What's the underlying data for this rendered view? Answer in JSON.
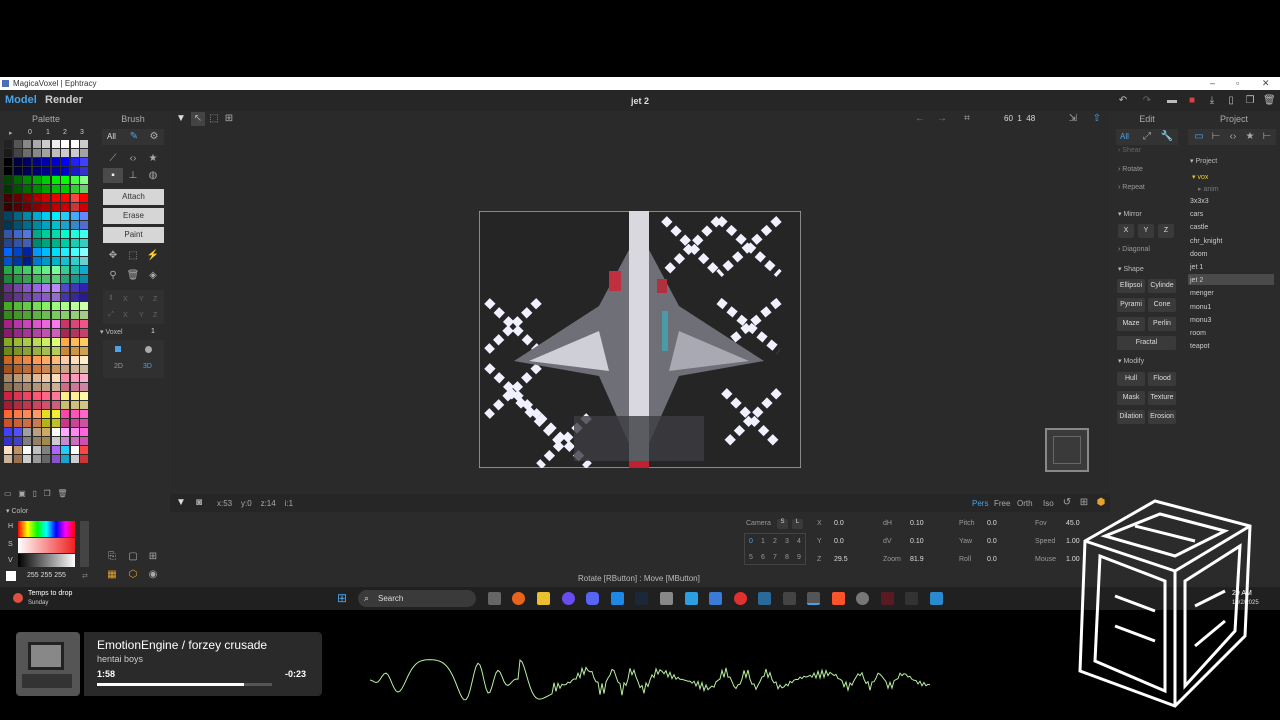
{
  "titlebar": {
    "title": "MagicaVoxel | Ephtracy"
  },
  "menubar": {
    "model": "Model",
    "render": "Render",
    "doc_title": "jet 2",
    "edit": "Edit",
    "project": "Project"
  },
  "palette": {
    "title": "Palette",
    "cols": [
      "0",
      "1",
      "2",
      "3"
    ]
  },
  "brush": {
    "title": "Brush",
    "all": "All",
    "attach": "Attach",
    "erase": "Erase",
    "paint": "Paint",
    "axes_x": "X",
    "axes_y": "Y",
    "axes_z": "Z",
    "voxel": "Voxel",
    "voxel_count": "1",
    "d2": "2D",
    "d3": "3D"
  },
  "color": {
    "title": "Color",
    "h": "H",
    "s": "S",
    "v": "V",
    "rgb": "255 255 255"
  },
  "viewport": {
    "dims": "60  1  48",
    "coords": "x:53    y:0    z:14    i:1",
    "status": "Rotate [RButton] : Move [MButton]"
  },
  "view_modes": {
    "pers": "Pers",
    "free": "Free",
    "orth": "Orth",
    "iso": "Iso"
  },
  "camera": {
    "camera": "Camera",
    "s": "S",
    "l": "L",
    "slots": [
      "0",
      "1",
      "2",
      "3",
      "4",
      "5",
      "6",
      "7",
      "8",
      "9"
    ],
    "x_label": "X",
    "x": "0.0",
    "y_label": "Y",
    "y": "0.0",
    "z_label": "Z",
    "z": "29.5",
    "dh_label": "dH",
    "dh": "0.10",
    "dv_label": "dV",
    "dv": "0.10",
    "zoom_label": "Zoom",
    "zoom": "81.9",
    "pitch_label": "Pitch",
    "pitch": "0.0",
    "yaw_label": "Yaw",
    "yaw": "0.0",
    "roll_label": "Roll",
    "roll": "0.0",
    "fov_label": "Fov",
    "fov": "45.0",
    "speed_label": "Speed",
    "speed": "1.00",
    "mouse_label": "Mouse",
    "mouse": "1.00"
  },
  "edit": {
    "all": "All",
    "shear": "Shear",
    "rotate": "Rotate",
    "repeat": "Repeat",
    "mirror": "Mirror",
    "mx": "X",
    "my": "Y",
    "mz": "Z",
    "diagonal": "Diagonal",
    "shape": "Shape",
    "ellipsoid": "Ellipsoi",
    "cylinder": "Cylinde",
    "pyramid": "Pyrami",
    "cone": "Cone",
    "maze": "Maze",
    "perlin": "Perlin",
    "fractal": "Fractal",
    "modify": "Modify",
    "hull": "Hull",
    "flood": "Flood",
    "mask": "Mask",
    "texture": "Texture",
    "dilation": "Dilation",
    "erosion": "Erosion"
  },
  "project": {
    "header": "Project",
    "folder": "vox",
    "sub": "anim",
    "items": [
      "3x3x3",
      "cars",
      "castle",
      "chr_knight",
      "doom",
      "jet 1",
      "jet 2",
      "menger",
      "monu1",
      "monu3",
      "room",
      "teapot"
    ],
    "selected": "jet 2"
  },
  "taskbar": {
    "weather": "Temps to drop",
    "weather_sub": "Sunday",
    "search": "Search",
    "time": "29 AM",
    "date": "10/2/2025"
  },
  "overlay": {
    "song": "EmotionEngine / forzey crusade",
    "artist": "hentai boys",
    "elapsed": "1:58",
    "remaining": "-0:23",
    "progress": 0.84
  },
  "colors": {
    "accent": "#4aa3e8",
    "selected": "#4a4a4a",
    "wave": "#b8f0a0"
  }
}
